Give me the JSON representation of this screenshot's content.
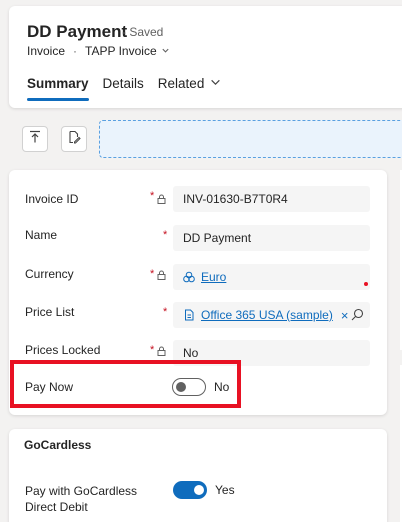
{
  "header": {
    "title": "DD Payment",
    "status": "- Saved",
    "entity": "Invoice",
    "separator": "·",
    "form_name": "TAPP Invoice"
  },
  "tabs": [
    {
      "label": "Summary",
      "active": true
    },
    {
      "label": "Details",
      "active": false
    },
    {
      "label": "Related",
      "active": false
    }
  ],
  "fields": {
    "invoice_id": {
      "label": "Invoice ID",
      "req": "*",
      "value": "INV-01630-B7T0R4"
    },
    "name": {
      "label": "Name",
      "req": "*",
      "value": "DD Payment"
    },
    "currency": {
      "label": "Currency",
      "req": "*",
      "value": "Euro"
    },
    "price_list": {
      "label": "Price List",
      "req": "*",
      "value": "Office 365 USA (sample)",
      "remove": "×"
    },
    "prices_locked": {
      "label": "Prices Locked",
      "req": "*",
      "value": "No"
    },
    "pay_now": {
      "label": "Pay Now",
      "state": "No",
      "on": false
    }
  },
  "gocardless": {
    "title": "GoCardless",
    "direct_debit": {
      "label": "Pay with GoCardless Direct Debit",
      "state": "Yes",
      "on": true
    }
  },
  "colors": {
    "accent": "#0f6cbd",
    "highlight": "#e81123",
    "required": "#c50f1f"
  }
}
